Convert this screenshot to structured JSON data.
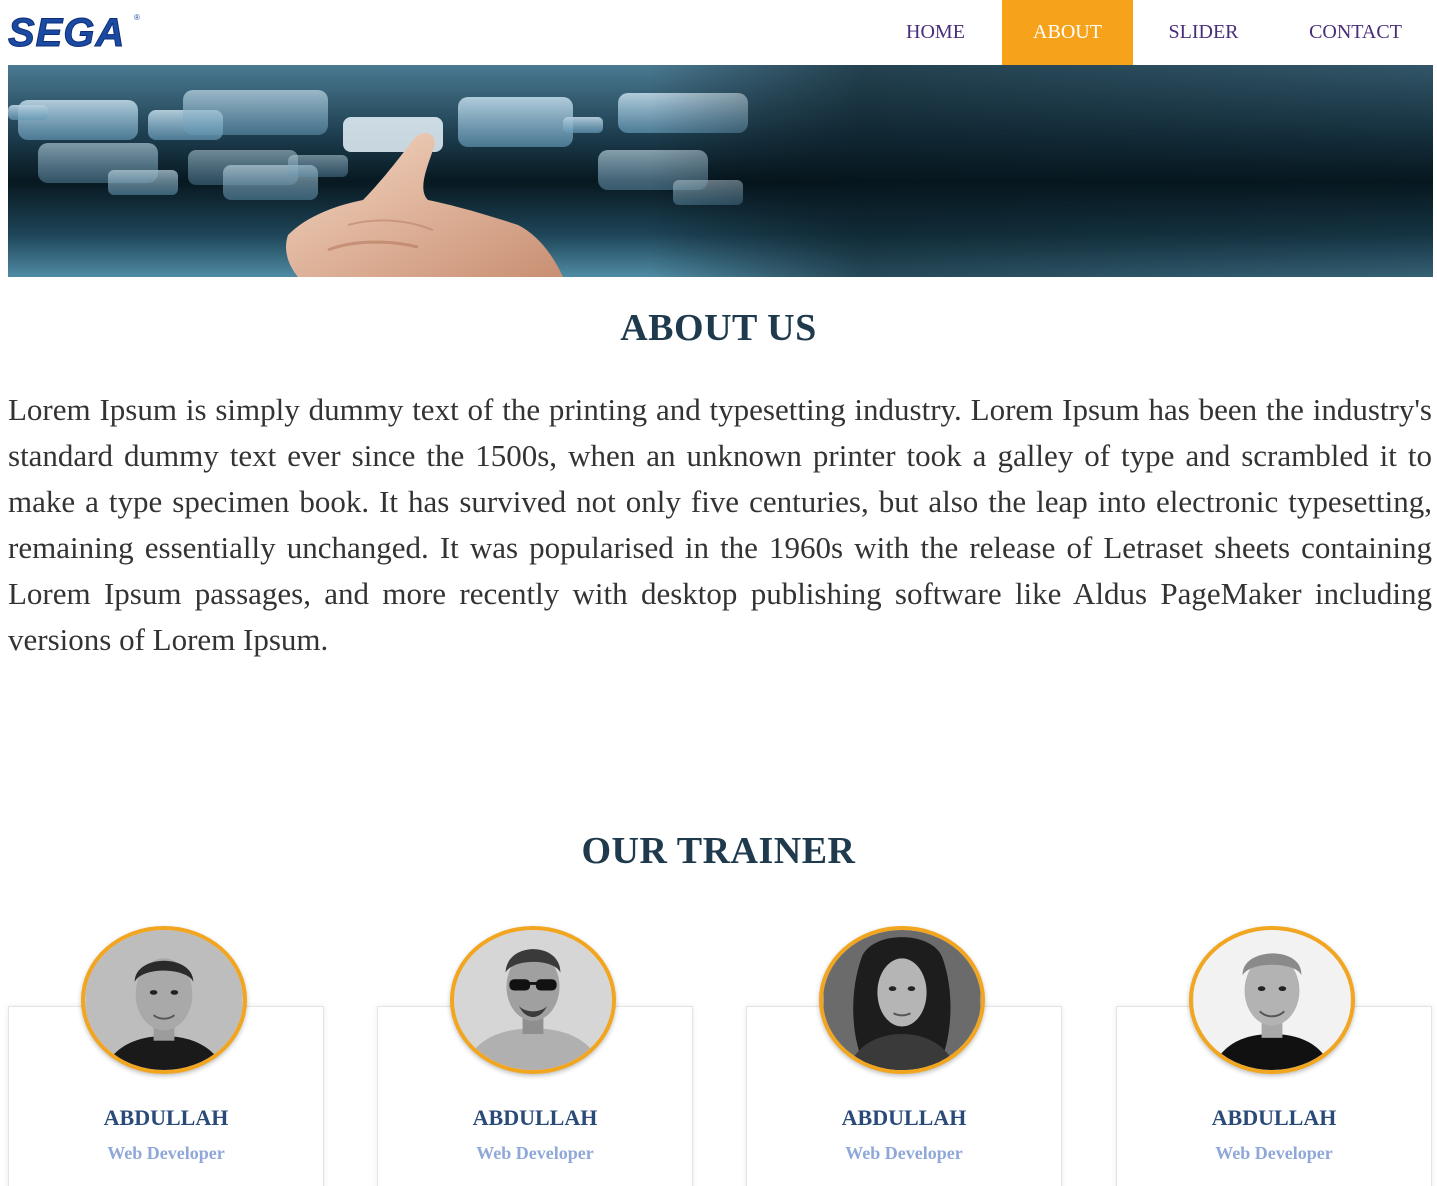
{
  "header": {
    "logo_text": "SEGA",
    "nav": [
      {
        "label": "HOME",
        "active": false
      },
      {
        "label": "ABOUT",
        "active": true
      },
      {
        "label": "SLIDER",
        "active": false
      },
      {
        "label": "CONTACT",
        "active": false
      }
    ]
  },
  "colors": {
    "accent": "#f7a21b",
    "nav_text": "#4a2d7a",
    "heading": "#1e3a4c",
    "trainer_name": "#2a4a78",
    "trainer_role": "#8fa8d8"
  },
  "about": {
    "title": "ABOUT US",
    "text": "Lorem Ipsum is simply dummy text of the printing and typesetting industry. Lorem Ipsum has been the industry's standard dummy text ever since the 1500s, when an unknown printer took a galley of type and scrambled it to make a type specimen book. It has survived not only five centuries, but also the leap into electronic typesetting, remaining essentially unchanged. It was popularised in the 1960s with the release of Letraset sheets containing Lorem Ipsum passages, and more recently with desktop publishing software like Aldus PageMaker including versions of Lorem Ipsum."
  },
  "trainers": {
    "title": "OUR TRAINER",
    "items": [
      {
        "name": "ABDULLAH",
        "role": "Web Developer"
      },
      {
        "name": "ABDULLAH",
        "role": "Web Developer"
      },
      {
        "name": "ABDULLAH",
        "role": "Web Developer"
      },
      {
        "name": "ABDULLAH",
        "role": "Web Developer"
      }
    ]
  }
}
